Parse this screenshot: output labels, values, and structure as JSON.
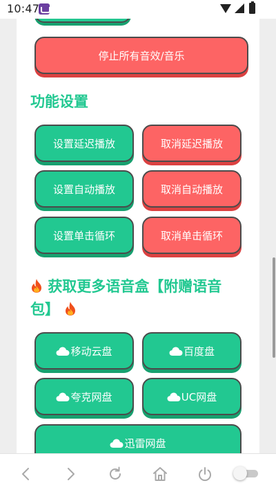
{
  "status_bar": {
    "time": "10:47"
  },
  "buttons": {
    "stop_all": "停止所有音效/音乐",
    "set_delay": "设置延迟播放",
    "cancel_delay": "取消延迟播放",
    "set_auto": "设置自动播放",
    "cancel_auto": "取消自动播放",
    "set_loop": "设置单击循环",
    "cancel_loop": "取消单击循环"
  },
  "sections": {
    "function_settings": "功能设置",
    "get_more_line1": "获取更多语音盒【附赠语音",
    "get_more_line2": "包】"
  },
  "cloud_links": {
    "mobile": "移动云盘",
    "baidu": "百度盘",
    "quark": "夸克网盘",
    "uc": "UC网盘",
    "xunlei": "迅雷网盘"
  },
  "colors": {
    "green": "#22c891",
    "red": "#fd6464",
    "title_green": "#22c891"
  },
  "icons": {
    "cloud": "cloud-icon",
    "fire": "fire-icon"
  }
}
